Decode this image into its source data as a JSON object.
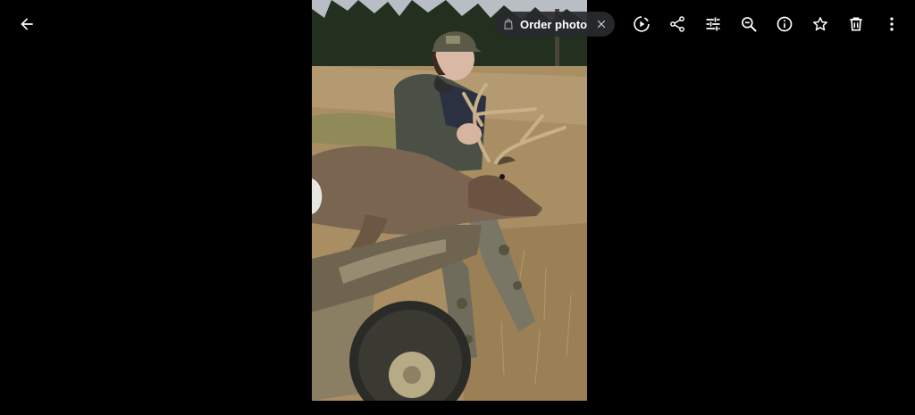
{
  "toolbar": {
    "back_icon": "arrow-back-icon",
    "order_chip": {
      "label": "Order photo",
      "icon": "shopping-bag-icon",
      "close_icon": "close-icon"
    },
    "actions": [
      {
        "name": "slideshow-button",
        "icon": "play-circle-icon"
      },
      {
        "name": "share-button",
        "icon": "share-icon"
      },
      {
        "name": "edit-button",
        "icon": "tune-icon"
      },
      {
        "name": "zoom-out-button",
        "icon": "zoom-out-icon"
      },
      {
        "name": "info-button",
        "icon": "info-icon"
      },
      {
        "name": "favorite-button",
        "icon": "star-outline-icon"
      },
      {
        "name": "delete-button",
        "icon": "trash-icon"
      },
      {
        "name": "more-options-button",
        "icon": "more-vert-icon"
      }
    ]
  },
  "colors": {
    "background": "#000000",
    "icon": "#ffffff",
    "chip_bg": "#282a2e"
  }
}
